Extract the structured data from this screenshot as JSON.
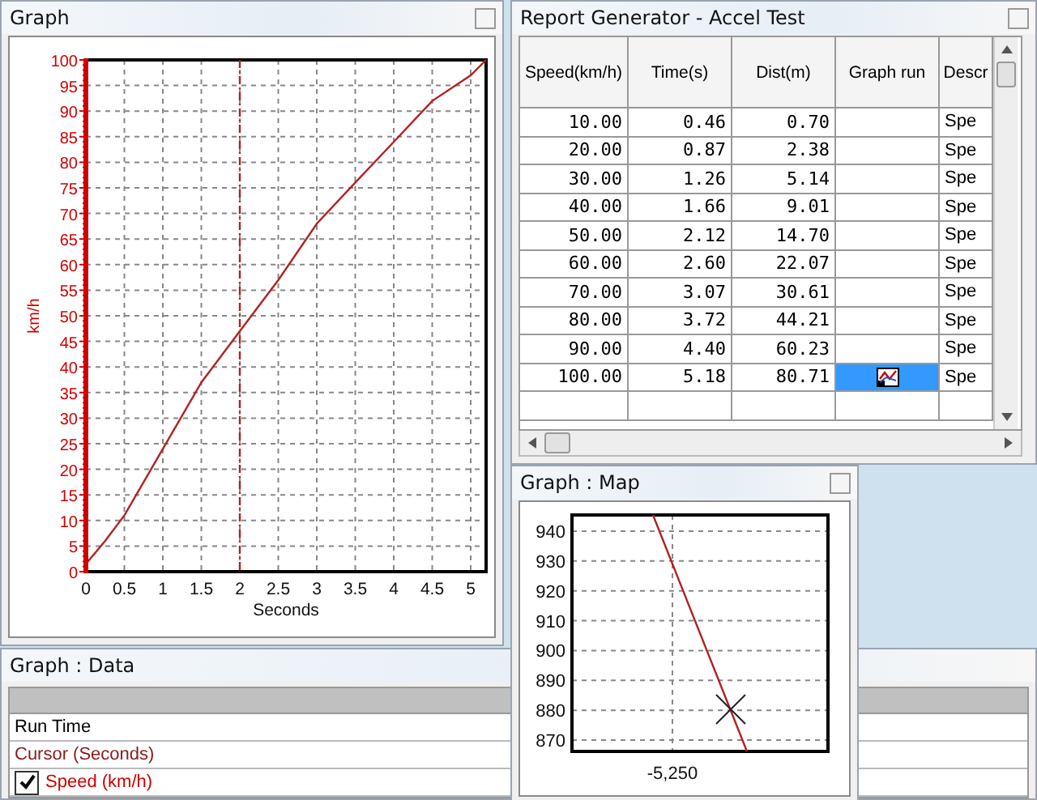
{
  "graph": {
    "title": "Graph",
    "chart_data": {
      "type": "line",
      "xlabel": "Seconds",
      "ylabel": "km/h",
      "xlim": [
        0,
        5.2
      ],
      "ylim": [
        0,
        100
      ],
      "xticks": [
        {
          "value": 0,
          "label": "0"
        },
        {
          "value": 0.5,
          "label": "0.5"
        },
        {
          "value": 1,
          "label": "1"
        },
        {
          "value": 1.5,
          "label": "1.5"
        },
        {
          "value": 2,
          "label": "2"
        },
        {
          "value": 2.5,
          "label": "2.5"
        },
        {
          "value": 3,
          "label": "3"
        },
        {
          "value": 3.5,
          "label": "3.5"
        },
        {
          "value": 4,
          "label": "4"
        },
        {
          "value": 4.5,
          "label": "4.5"
        },
        {
          "value": 5,
          "label": "5"
        }
      ],
      "yticks": [
        0,
        5,
        10,
        15,
        20,
        25,
        30,
        35,
        40,
        45,
        50,
        55,
        60,
        65,
        70,
        75,
        80,
        85,
        90,
        95,
        100
      ],
      "x": [
        0,
        0.25,
        0.5,
        1,
        1.5,
        2,
        2.5,
        3,
        3.5,
        4,
        4.5,
        5,
        5.2
      ],
      "series": [
        {
          "color": "#b22222",
          "values": [
            1.5,
            6,
            11,
            24,
            37,
            47,
            57,
            68,
            76,
            84,
            92,
            97,
            100
          ]
        }
      ],
      "grid": true,
      "ref_lines": [
        {
          "axis": "x",
          "value": 2
        }
      ]
    }
  },
  "report": {
    "title": "Report Generator - Accel Test",
    "columns": [
      "Speed(km/h)",
      "Time(s)",
      "Dist(m)",
      "Graph run",
      "Descr"
    ],
    "rows": [
      {
        "speed": "10.00",
        "time": "0.46",
        "dist": "0.70",
        "graph_icon": false,
        "selected": false,
        "descr": "Spe"
      },
      {
        "speed": "20.00",
        "time": "0.87",
        "dist": "2.38",
        "graph_icon": false,
        "selected": false,
        "descr": "Spe"
      },
      {
        "speed": "30.00",
        "time": "1.26",
        "dist": "5.14",
        "graph_icon": false,
        "selected": false,
        "descr": "Spe"
      },
      {
        "speed": "40.00",
        "time": "1.66",
        "dist": "9.01",
        "graph_icon": false,
        "selected": false,
        "descr": "Spe"
      },
      {
        "speed": "50.00",
        "time": "2.12",
        "dist": "14.70",
        "graph_icon": false,
        "selected": false,
        "descr": "Spe"
      },
      {
        "speed": "60.00",
        "time": "2.60",
        "dist": "22.07",
        "graph_icon": false,
        "selected": false,
        "descr": "Spe"
      },
      {
        "speed": "70.00",
        "time": "3.07",
        "dist": "30.61",
        "graph_icon": false,
        "selected": false,
        "descr": "Spe"
      },
      {
        "speed": "80.00",
        "time": "3.72",
        "dist": "44.21",
        "graph_icon": false,
        "selected": false,
        "descr": "Spe"
      },
      {
        "speed": "90.00",
        "time": "4.40",
        "dist": "60.23",
        "graph_icon": false,
        "selected": false,
        "descr": "Spe"
      },
      {
        "speed": "100.00",
        "time": "5.18",
        "dist": "80.71",
        "graph_icon": true,
        "selected": true,
        "descr": "Spe"
      }
    ]
  },
  "map": {
    "title": "Graph : Map",
    "y_tick_labels": [
      "940",
      "930",
      "920",
      "910",
      "900",
      "890",
      "880",
      "870"
    ],
    "x_tick_label": "-5,250"
  },
  "data": {
    "title": "Graph : Data",
    "rows": [
      {
        "kind": "label",
        "label": "Run Time",
        "color": "#000000"
      },
      {
        "kind": "label",
        "label": "Cursor (Seconds)",
        "color": "#8b1a1a"
      },
      {
        "kind": "checkbox",
        "label": "Speed (km/h)",
        "color": "#cc0000",
        "checked": true
      }
    ]
  }
}
